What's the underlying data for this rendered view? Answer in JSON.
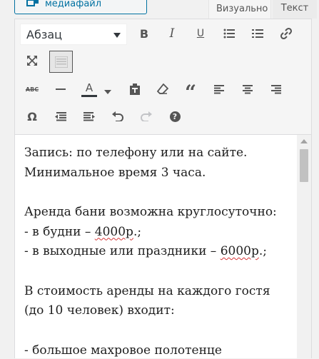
{
  "header": {
    "add_media_label": "Добавить медиафайл",
    "tabs": {
      "visual": "Визуально",
      "text": "Текст"
    }
  },
  "toolbar": {
    "format_select": "Абзац",
    "row1_icons": [
      "bold-icon",
      "italic-icon",
      "underline-icon",
      "bullet-list-icon",
      "numbered-list-icon",
      "link-icon"
    ],
    "row2_icons": [
      "fullscreen-icon",
      "toolbar-toggle-icon"
    ],
    "row3_icons": [
      "strikethrough-icon",
      "horizontal-line-icon",
      "text-color-icon",
      "paste-text-icon",
      "clear-formatting-icon",
      "blockquote-icon",
      "align-left-icon",
      "align-center-icon",
      "align-right-icon"
    ],
    "row4_icons": [
      "special-character-icon",
      "outdent-icon",
      "indent-icon",
      "undo-icon",
      "redo-icon",
      "help-icon"
    ],
    "strike_label": "ABC",
    "text_color_letter": "A",
    "quote_glyph": "“",
    "omega_glyph": "Ω",
    "help_glyph": "?"
  },
  "content": {
    "p1_line1": "Запись: по телефону или на сайте.",
    "p1_line2": "Минимальное время 3 часа.",
    "p2_line1": "Аренда бани возможна круглосуточно:",
    "p2_line2_pre": "- в будни – ",
    "p2_line2_price": "4000р",
    "p2_line2_post": ".;",
    "p2_line3_pre": "- в выходные или праздники – ",
    "p2_line3_price": "6000р",
    "p2_line3_post": ".;",
    "p3_line1": "В стоимость аренды на каждого гостя",
    "p3_line2": "(до 10 человек) входит:",
    "p4_line1": "- большое махровое полотенце"
  },
  "colors": {
    "accent": "#0071a1",
    "icon": "#555555",
    "spellcheck": "#d63638"
  }
}
